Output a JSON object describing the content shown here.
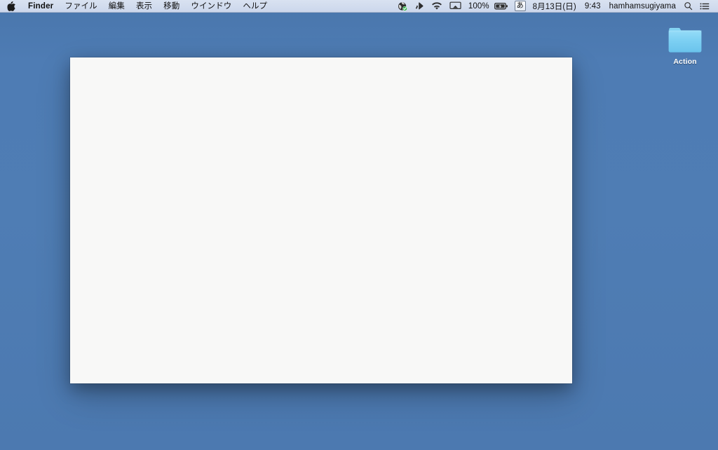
{
  "menubar": {
    "apple_icon": "apple-logo-icon",
    "app_name": "Finder",
    "items": [
      {
        "label": "Finder",
        "bold": true
      },
      {
        "label": "ファイル",
        "bold": false
      },
      {
        "label": "編集",
        "bold": false
      },
      {
        "label": "表示",
        "bold": false
      },
      {
        "label": "移動",
        "bold": false
      },
      {
        "label": "ウインドウ",
        "bold": false
      },
      {
        "label": "ヘルプ",
        "bold": false
      }
    ],
    "status": {
      "dropbox_icon": "dropbox-sync-icon",
      "sound_icon": "volume-icon",
      "wifi_icon": "wifi-icon",
      "airplay_icon": "airplay-display-icon",
      "battery_percent": "100%",
      "battery_icon": "battery-charging-icon",
      "input_method": "あ",
      "date": "8月13日(日)",
      "time": "9:43",
      "username": "hamhamsugiyama",
      "spotlight_icon": "search-icon",
      "notification_icon": "notification-center-icon"
    }
  },
  "desktop": {
    "background_color": "#4e7cb4",
    "icons": [
      {
        "name": "Action",
        "type": "folder",
        "icon": "folder-icon",
        "color": "#7ed3f2"
      }
    ]
  },
  "window": {
    "title": "",
    "background_color": "#f8f8f7",
    "content": ""
  }
}
